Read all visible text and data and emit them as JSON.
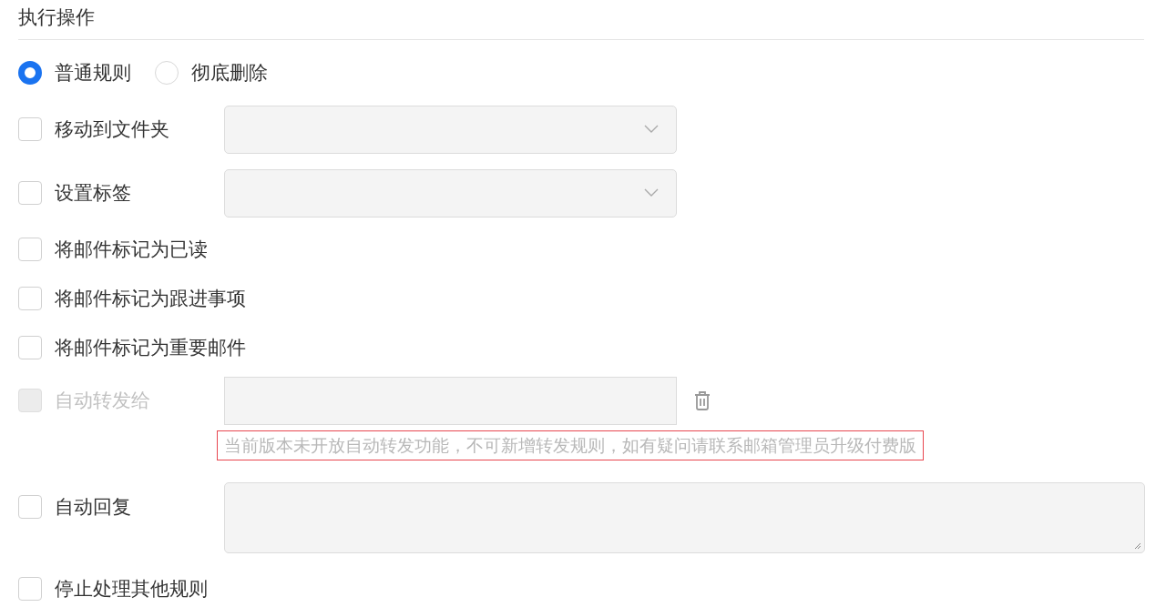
{
  "section_title": "执行操作",
  "modes": [
    {
      "label": "普通规则",
      "selected": true
    },
    {
      "label": "彻底删除",
      "selected": false
    }
  ],
  "actions": [
    {
      "kind": "select",
      "label": "移动到文件夹",
      "checked": false,
      "disabled": false
    },
    {
      "kind": "select",
      "label": "设置标签",
      "checked": false,
      "disabled": false
    },
    {
      "kind": "plain",
      "label": "将邮件标记为已读",
      "checked": false,
      "disabled": false
    },
    {
      "kind": "plain",
      "label": "将邮件标记为跟进事项",
      "checked": false,
      "disabled": false
    },
    {
      "kind": "plain",
      "label": "将邮件标记为重要邮件",
      "checked": false,
      "disabled": false
    },
    {
      "kind": "input",
      "label": "自动转发给",
      "checked": false,
      "disabled": true,
      "note": "当前版本未开放自动转发功能，不可新增转发规则，如有疑问请联系邮箱管理员升级付费版"
    },
    {
      "kind": "textarea",
      "label": "自动回复",
      "checked": false,
      "disabled": false
    },
    {
      "kind": "plain",
      "label": "停止处理其他规则",
      "checked": false,
      "disabled": false
    }
  ]
}
